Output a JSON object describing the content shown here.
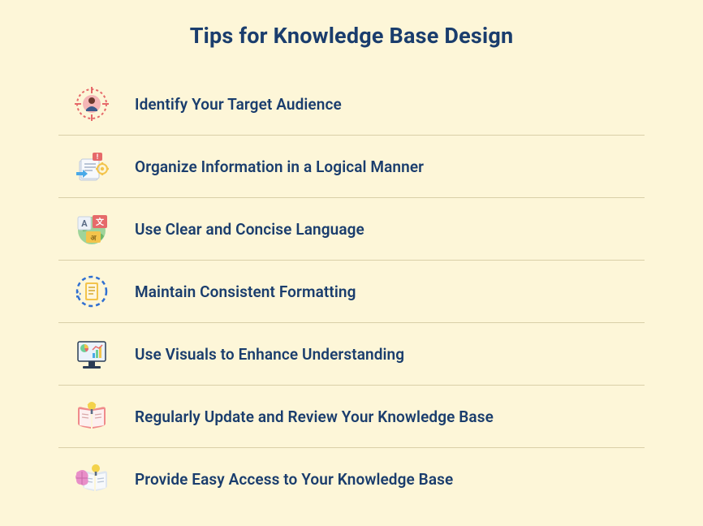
{
  "title": "Tips for Knowledge Base Design",
  "tips": [
    {
      "icon": "target-audience-icon",
      "label": "Identify Your Target Audience"
    },
    {
      "icon": "organize-icon",
      "label": "Organize Information in a Logical Manner"
    },
    {
      "icon": "language-icon",
      "label": "Use Clear and Concise Language"
    },
    {
      "icon": "formatting-icon",
      "label": "Maintain Consistent Formatting"
    },
    {
      "icon": "visuals-icon",
      "label": "Use Visuals to Enhance Understanding"
    },
    {
      "icon": "update-icon",
      "label": "Regularly Update and Review Your Knowledge Base"
    },
    {
      "icon": "access-icon",
      "label": "Provide Easy Access to Your Knowledge Base"
    }
  ],
  "colors": {
    "background": "#fdf6d8",
    "text": "#1a3d6d",
    "divider": "#d9cfa8"
  }
}
